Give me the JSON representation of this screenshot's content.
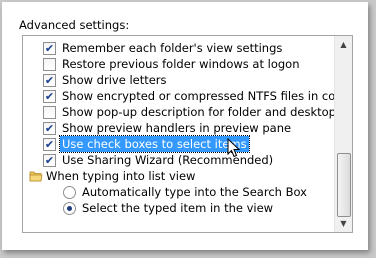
{
  "advanced_settings": {
    "heading": "Advanced settings:",
    "items": [
      {
        "type": "checkbox",
        "label": "Remember each folder's view settings",
        "checked": true
      },
      {
        "type": "checkbox",
        "label": "Restore previous folder windows at logon",
        "checked": false
      },
      {
        "type": "checkbox",
        "label": "Show drive letters",
        "checked": true
      },
      {
        "type": "checkbox",
        "label": "Show encrypted or compressed NTFS files in color",
        "checked": true
      },
      {
        "type": "checkbox",
        "label": "Show pop-up description for folder and desktop items",
        "checked": false
      },
      {
        "type": "checkbox",
        "label": "Show preview handlers in preview pane",
        "checked": true
      },
      {
        "type": "checkbox",
        "label": "Use check boxes to select items",
        "checked": true,
        "selected": true
      },
      {
        "type": "checkbox",
        "label": "Use Sharing Wizard (Recommended)",
        "checked": true
      },
      {
        "type": "folder",
        "label": "When typing into list view",
        "icon": "folder-icon"
      },
      {
        "type": "radio",
        "label": "Automatically type into the Search Box",
        "checked": false
      },
      {
        "type": "radio",
        "label": "Select the typed item in the view",
        "checked": true
      }
    ],
    "check_glyph": "✔",
    "scroll_up_glyph": "▲",
    "scroll_down_glyph": "▼",
    "selection_color": "#3399ff"
  }
}
